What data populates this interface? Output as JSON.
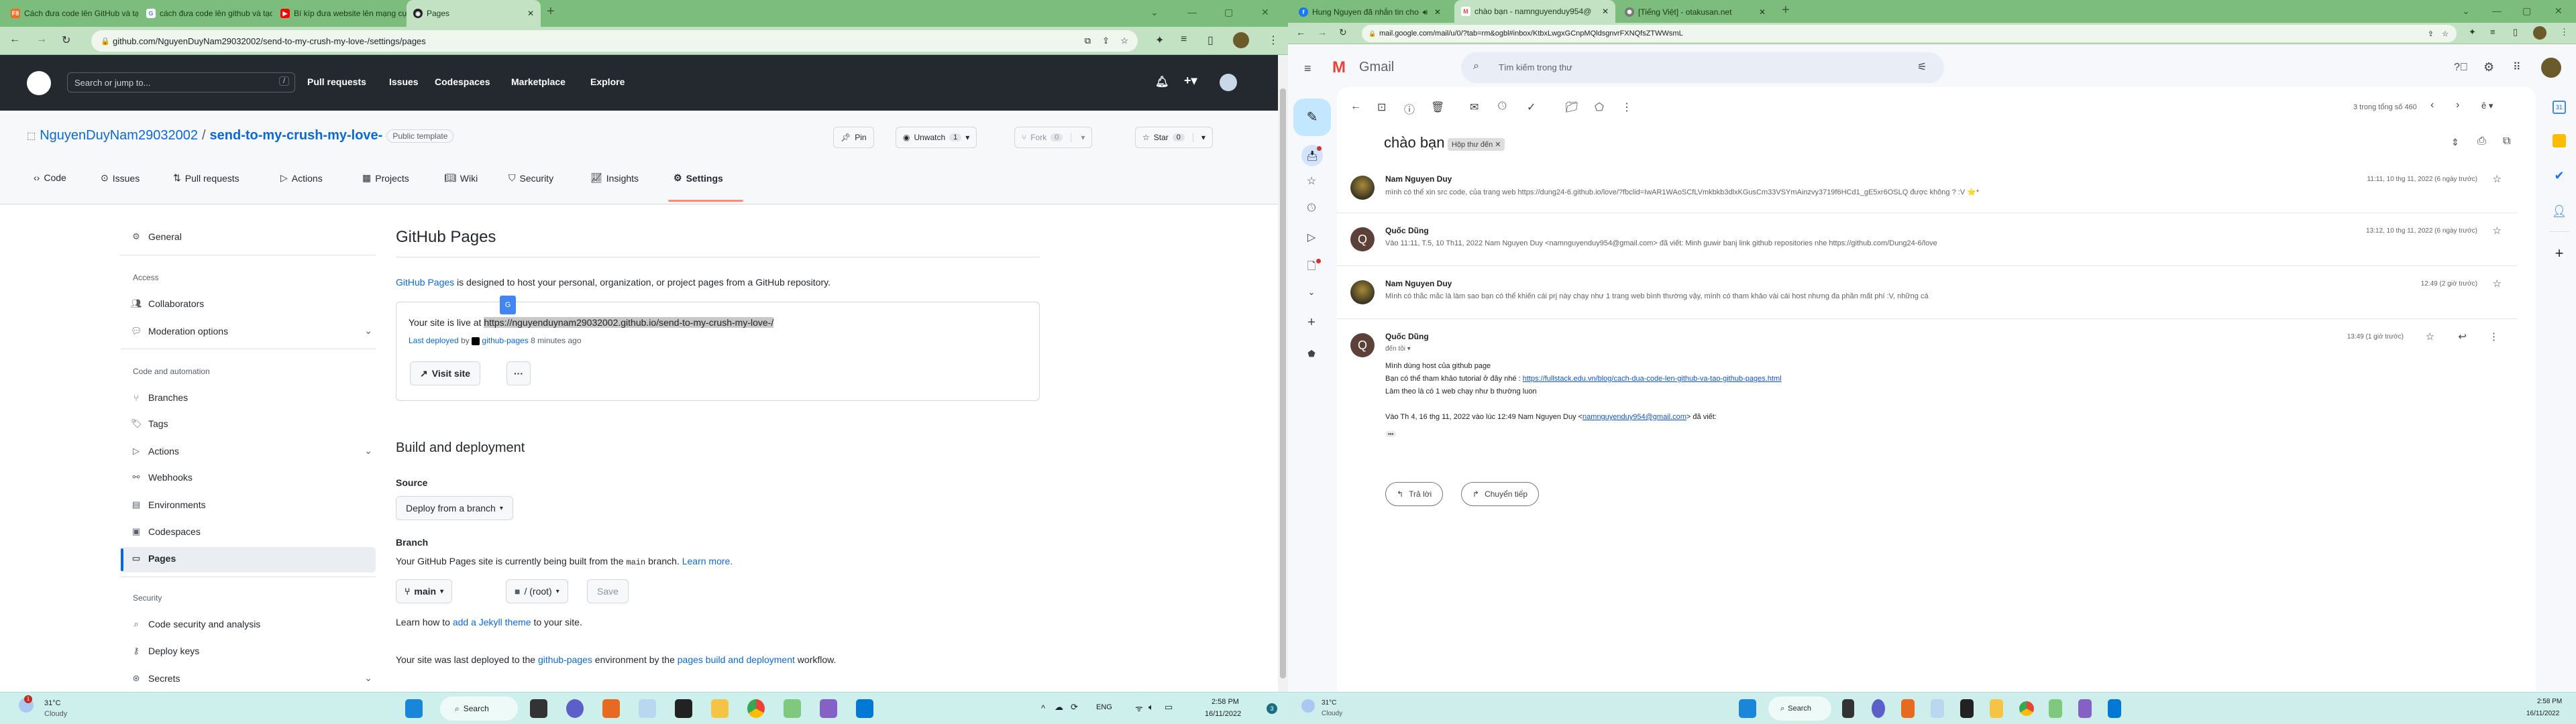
{
  "left_window": {
    "tabs": [
      {
        "label": "Cách đưa code lên GitHub và tạo",
        "icon": "fullstack-icon"
      },
      {
        "label": "cách đưa code lên github và tạo",
        "icon": "google-icon"
      },
      {
        "label": "Bí kíp đưa website lên mạng cực",
        "icon": "youtube-icon"
      },
      {
        "label": "Pages",
        "icon": "github-icon"
      }
    ],
    "url": "github.com/NguyenDuyNam29032002/send-to-my-crush-my-love-/settings/pages",
    "header": {
      "search_placeholder": "Search or jump to...",
      "slash": "/",
      "nav": [
        "Pull requests",
        "Issues",
        "Codespaces",
        "Marketplace",
        "Explore"
      ]
    },
    "repo": {
      "owner": "NguyenDuyNam29032002",
      "sep": "/",
      "name": "send-to-my-crush-my-love-",
      "badge": "Public template",
      "pin": "Pin",
      "unwatch": "Unwatch",
      "watch_count": "1",
      "fork": "Fork",
      "fork_count": "0",
      "star": "Star",
      "star_count": "0"
    },
    "repo_tabs": [
      "Code",
      "Issues",
      "Pull requests",
      "Actions",
      "Projects",
      "Wiki",
      "Security",
      "Insights",
      "Settings"
    ],
    "sidebar": {
      "general": "General",
      "access_heading": "Access",
      "collaborators": "Collaborators",
      "moderation": "Moderation options",
      "code_heading": "Code and automation",
      "branches": "Branches",
      "tags": "Tags",
      "actions": "Actions",
      "webhooks": "Webhooks",
      "environments": "Environments",
      "codespaces": "Codespaces",
      "pages": "Pages",
      "security_heading": "Security",
      "code_security": "Code security and analysis",
      "deploy_keys": "Deploy keys",
      "secrets": "Secrets"
    },
    "pages": {
      "title": "GitHub Pages",
      "intro_link": "GitHub Pages",
      "intro_rest": " is designed to host your personal, organization, or project pages from a GitHub repository.",
      "live_prefix": "Your site is live at ",
      "live_url": "https://nguyenduynam29032002.github.io/send-to-my-crush-my-love-/",
      "last_deployed": "Last deployed",
      "by": " by ",
      "deployer": "github-pages",
      "ago": " 8 minutes ago",
      "visit_site": "Visit site",
      "more": "···",
      "build_title": "Build and deployment",
      "source_label": "Source",
      "source_value": "Deploy from a branch",
      "branch_label": "Branch",
      "branch_text_1": "Your GitHub Pages site is currently being built from the ",
      "branch_code": "main",
      "branch_text_2": " branch. ",
      "learn_more": "Learn more.",
      "branch_select": "main",
      "folder_select": "/ (root)",
      "save": "Save",
      "jekyll_1": "Learn how to ",
      "jekyll_link": "add a Jekyll theme",
      "jekyll_2": " to your site.",
      "last_1": "Your site was last deployed to the ",
      "last_env": "github-pages",
      "last_2": " environment by the ",
      "last_workflow": "pages build and deployment",
      "last_3": " workflow."
    }
  },
  "right_window": {
    "tabs": [
      {
        "label": "Hung Nguyen đã nhắn tin cho",
        "icon": "facebook-icon"
      },
      {
        "label": "chào bạn - namnguyenduy954@",
        "icon": "gmail-icon"
      },
      {
        "label": "[Tiếng Việt] - otakusan.net",
        "icon": "otakusan-icon"
      }
    ],
    "url": "mail.google.com/mail/u/0/?tab=rm&ogbl#inbox/KtbxLwgxGCnpMQldsgnvrFXNQfsZTWWsmL",
    "app_name": "Gmail",
    "search_placeholder": "Tìm kiếm trong thư",
    "pager": "3 trong tổng số 460",
    "subject": "chào bạn",
    "label": "Hộp thư đến",
    "messages": [
      {
        "sender": "Nam Nguyen Duy",
        "snippet": "mình có thể xin src code, của trang web https://dung24-6.github.io/love/?fbclid=IwAR1WAoSCfLVmkbkb3dlxKGusCm33VSYmAinzvy3719f6HCd1_gE5xr6OSLQ được không ? :V ⭐*",
        "date": "11:11, 10 thg 11, 2022 (6 ngày trước)"
      },
      {
        "sender": "Quốc Dũng",
        "snippet": "Vào 11:11, T.5, 10 Th11, 2022 Nam Nguyen Duy <namnguyenduy954@gmail.com> đã viết: Minh guwir banj link github repositories nhe https://github.com/Dung24-6/love",
        "date": "13:12, 10 thg 11, 2022 (6 ngày trước)"
      },
      {
        "sender": "Nam Nguyen Duy",
        "snippet": "Mình có thắc mắc là làm sao bạn có thể khiến cái prj này chạy như 1 trang web bình thường vậy, mình có tham khảo vài cái host nhưng đa phần mất phí :V, những cá",
        "date": "12:49 (2 giờ trước)"
      }
    ],
    "open_message": {
      "sender": "Quốc Dũng",
      "to": "đến tôi",
      "date": "13:49 (1 giờ trước)",
      "line1": "Mình dùng host của github page",
      "line2_prefix": "Bạn có thể tham khảo tutorial ở đây nhé : ",
      "line2_link": "https://fullstack.edu.vn/blog/cach-dua-code-len-github-va-tao-github-pages.html",
      "line3": "Làm theo là có 1 web chạy như b thường luon",
      "quote_prefix": "Vào Th 4, 16 thg 11, 2022 vào lúc 12:49 Nam Nguyen Duy <",
      "quote_email": "namnguyenduy954@gmail.com",
      "quote_suffix": "> đã viết:",
      "ellipsis": "•••"
    },
    "reply": "Trả lời",
    "forward": "Chuyển tiếp",
    "calendar_day": "31"
  },
  "taskbar": {
    "temp": "31°C",
    "weather": "Cloudy",
    "weather_badge": "1",
    "search": "Search",
    "lang": "ENG",
    "time": "2:58 PM",
    "date": "16/11/2022",
    "notif": "3"
  }
}
